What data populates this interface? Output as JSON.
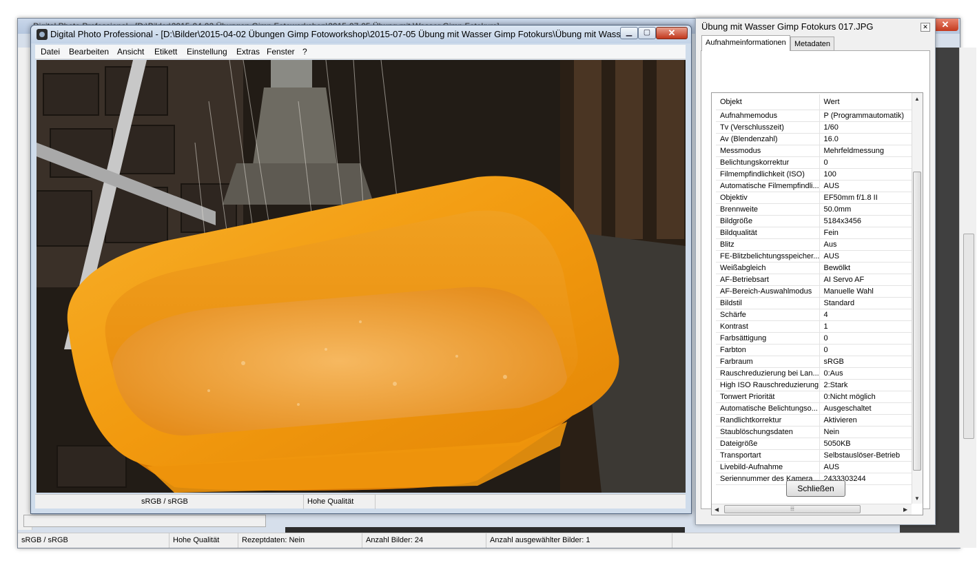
{
  "background_window": {
    "title": "Digital Photo Professional - [D:\\Bilder\\2015-04-02 Übungen  Gimp Fotoworkshop\\2015-07-05 Übung mit Wasser Gimp Fotokurs]",
    "status": {
      "color_space": "sRGB / sRGB",
      "quality": "Hohe Qualität",
      "recipe": "Rezeptdaten: Nein",
      "count": "Anzahl Bilder: 24",
      "selected": "Anzahl ausgewählter Bilder: 1"
    }
  },
  "viewer": {
    "title": "Digital Photo Professional - [D:\\Bilder\\2015-04-02 Übungen  Gimp Fotoworkshop\\2015-07-05 Übung mit Wasser Gimp Fotokurs\\Übung mit Wasser Gim...",
    "menu": [
      "Datei",
      "Bearbeiten",
      "Ansicht",
      "Etikett",
      "Einstellung",
      "Extras",
      "Fenster",
      "?"
    ],
    "status": {
      "color_space": "sRGB / sRGB",
      "quality": "Hohe Qualität"
    }
  },
  "dialog": {
    "title": "Übung mit Wasser Gimp Fotokurs 017.JPG",
    "tabs": [
      "Aufnahmeinformationen",
      "Metadaten"
    ],
    "columns": [
      "Objekt",
      "Wert"
    ],
    "rows": [
      [
        "Aufnahmemodus",
        "P (Programmautomatik)"
      ],
      [
        "Tv (Verschlusszeit)",
        "1/60"
      ],
      [
        "Av (Blendenzahl)",
        "16.0"
      ],
      [
        "Messmodus",
        "Mehrfeldmessung"
      ],
      [
        "Belichtungskorrektur",
        "0"
      ],
      [
        "Filmempfindlichkeit (ISO)",
        "100"
      ],
      [
        "Automatische Filmempfindli...",
        "AUS"
      ],
      [
        "Objektiv",
        "EF50mm f/1.8 II"
      ],
      [
        "Brennweite",
        "50.0mm"
      ],
      [
        "Bildgröße",
        "5184x3456"
      ],
      [
        "Bildqualität",
        "Fein"
      ],
      [
        "Blitz",
        "Aus"
      ],
      [
        "FE-Blitzbelichtungsspeicher...",
        "AUS"
      ],
      [
        "Weißabgleich",
        "Bewölkt"
      ],
      [
        "AF-Betriebsart",
        "AI Servo AF"
      ],
      [
        "AF-Bereich-Auswahlmodus",
        "Manuelle  Wahl"
      ],
      [
        "Bildstil",
        "Standard"
      ],
      [
        "Schärfe",
        "4"
      ],
      [
        "Kontrast",
        "1"
      ],
      [
        "Farbsättigung",
        "0"
      ],
      [
        "Farbton",
        "0"
      ],
      [
        "Farbraum",
        "sRGB"
      ],
      [
        "Rauschreduzierung bei Lan...",
        "0:Aus"
      ],
      [
        "High ISO Rauschreduzierung",
        "2:Stark"
      ],
      [
        "Tonwert Priorität",
        "0:Nicht möglich"
      ],
      [
        "Automatische Belichtungso...",
        "Ausgeschaltet"
      ],
      [
        "Randlichtkorrektur",
        "Aktivieren"
      ],
      [
        "Staublöschungsdaten",
        "Nein"
      ],
      [
        "Dateigröße",
        "5050KB"
      ],
      [
        "Transportart",
        "Selbstauslöser-Betrieb"
      ],
      [
        "Livebild-Aufnahme",
        "AUS"
      ],
      [
        "Seriennummer des Kamera...",
        "2433303244"
      ]
    ],
    "close_label": "Schließen"
  }
}
